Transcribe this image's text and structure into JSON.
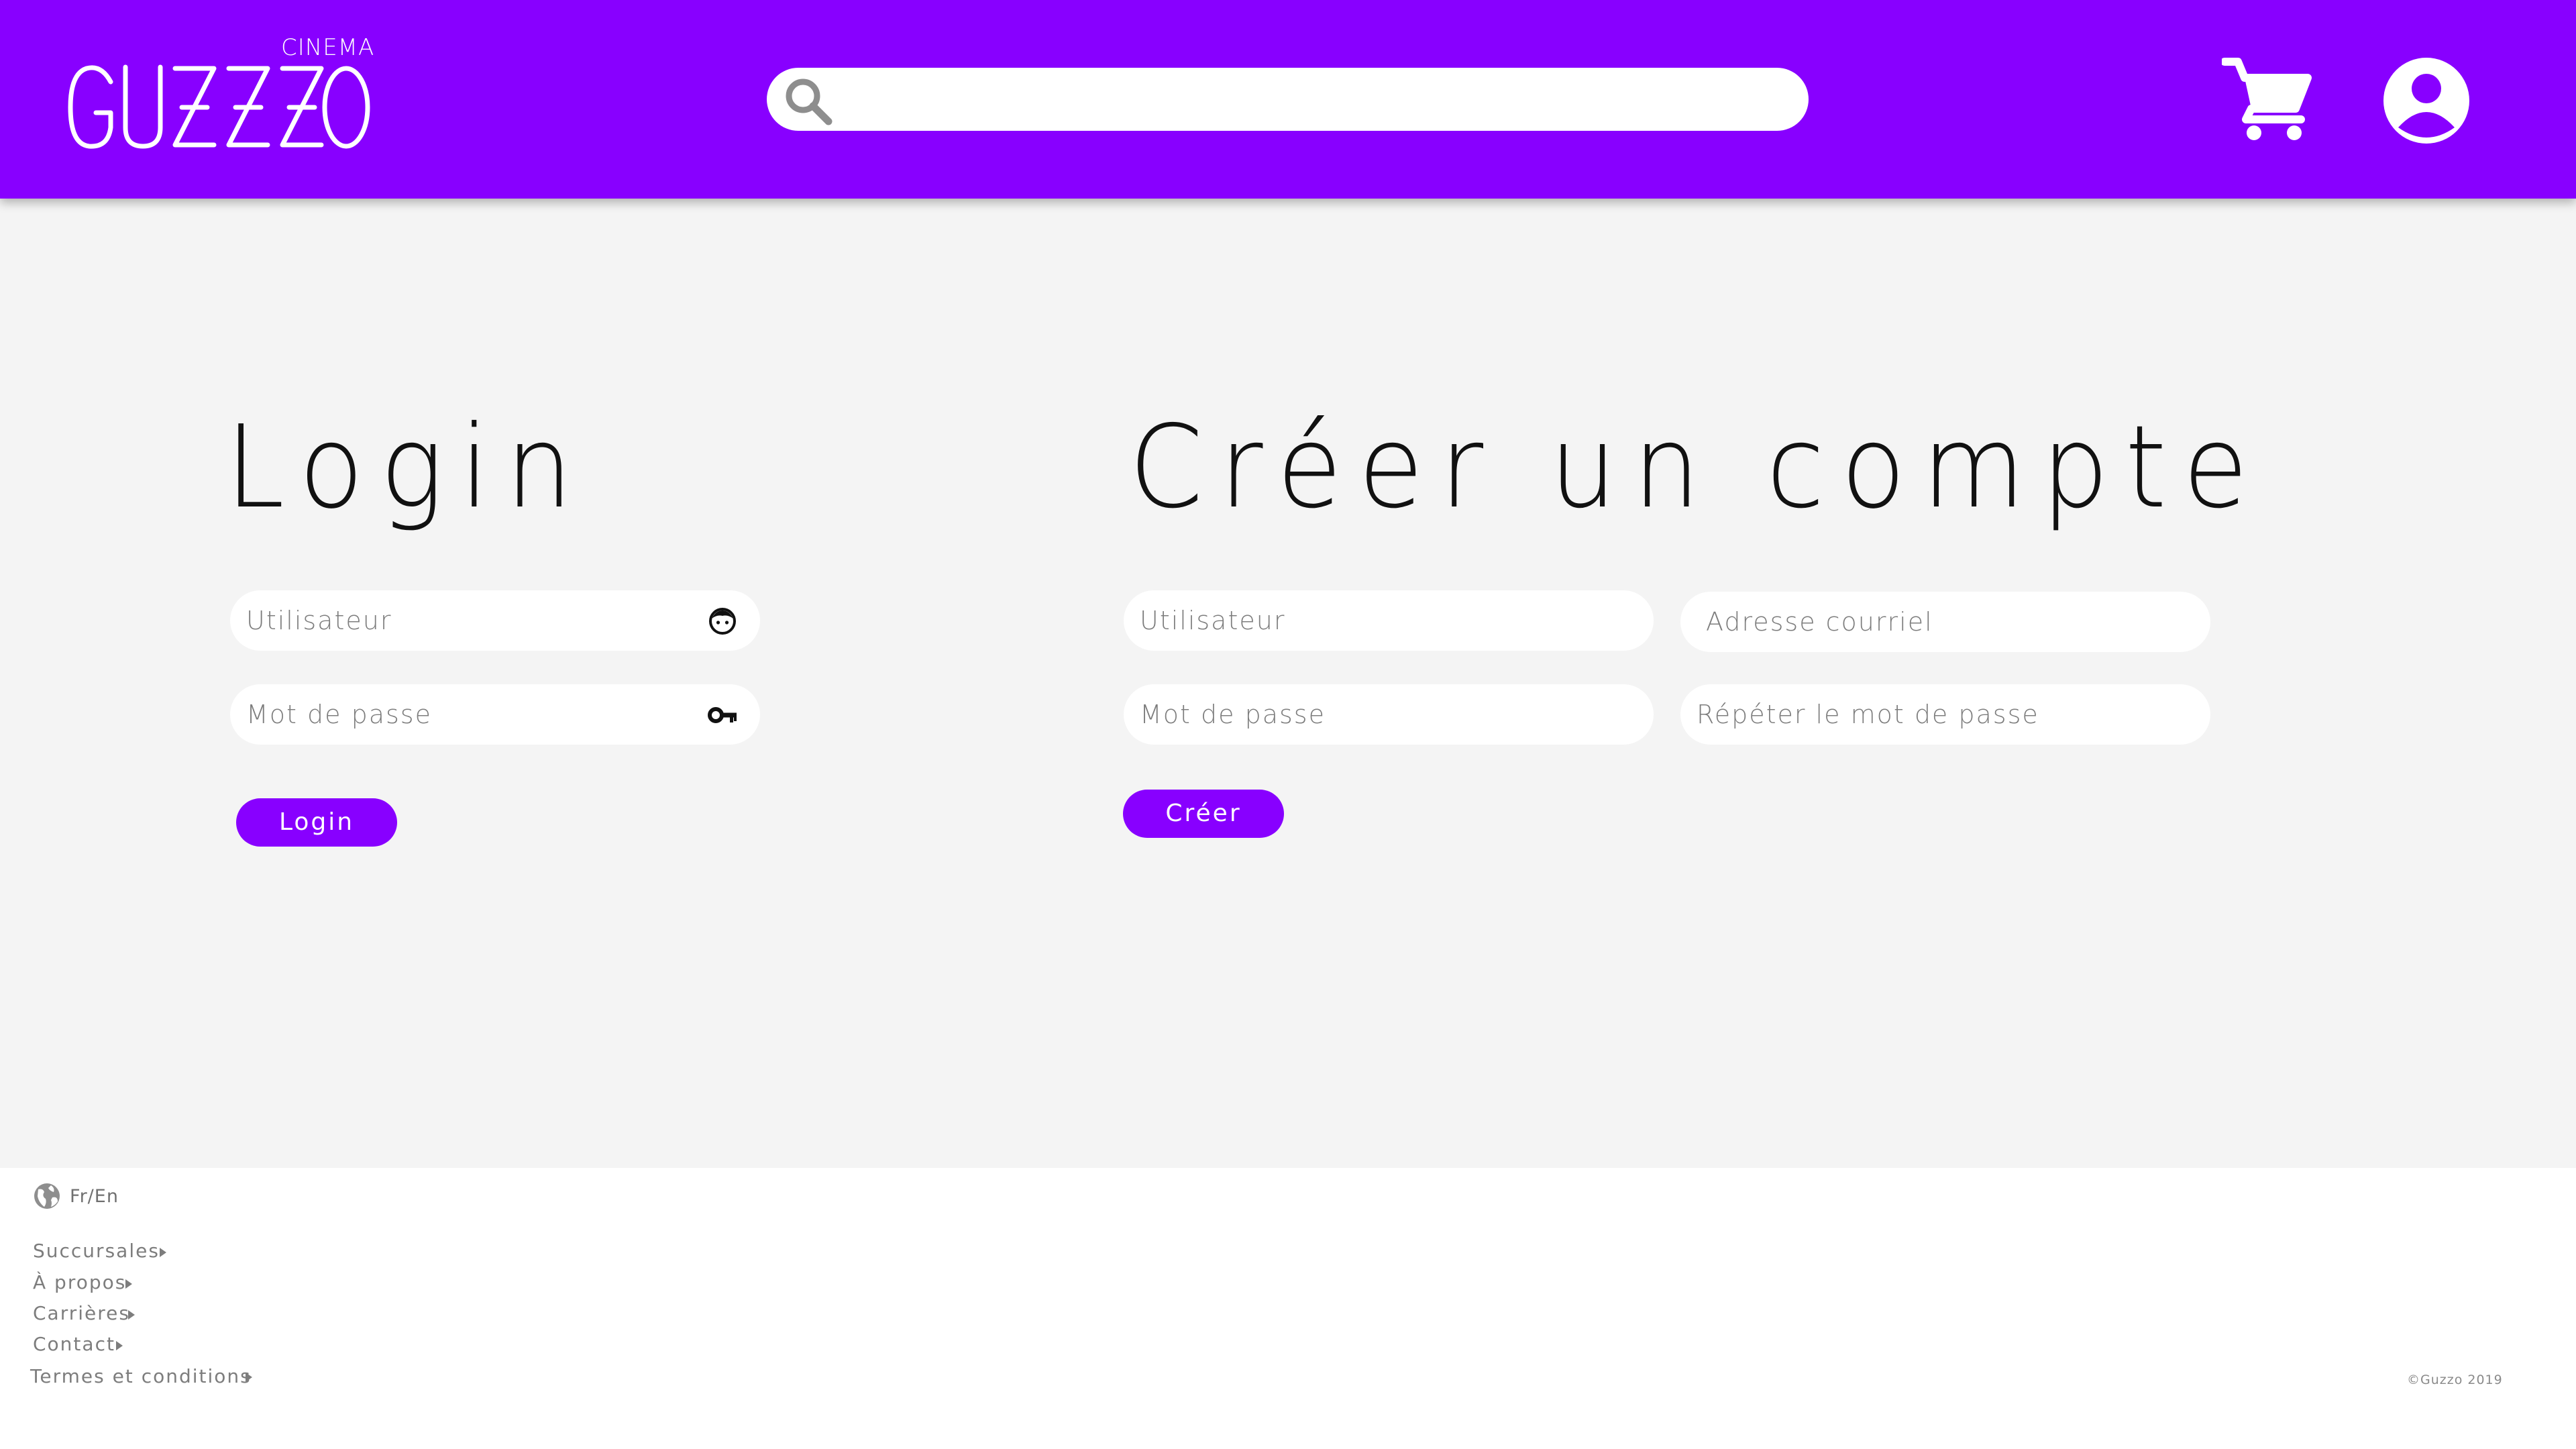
{
  "header": {
    "logo_brand": "GUZZO",
    "logo_subtitle": "CINEMA",
    "search_placeholder": "",
    "colors": {
      "primary": "#8800ff",
      "white": "#ffffff"
    },
    "icons": {
      "search": "search-icon",
      "cart": "cart-icon",
      "account": "account-icon"
    }
  },
  "login": {
    "title": "Login",
    "username_placeholder": "Utilisateur",
    "password_placeholder": "Mot de passe",
    "button_label": "Login",
    "icons": {
      "username": "face-icon",
      "password": "key-icon"
    }
  },
  "register": {
    "title": "Créer un compte",
    "username_placeholder": "Utilisateur",
    "email_placeholder": "Adresse courriel",
    "password_placeholder": "Mot de passe",
    "repeat_password_placeholder": "Répéter le mot de passe",
    "button_label": "Créer"
  },
  "footer": {
    "language_label": "Fr/En",
    "links": [
      {
        "label": "Succursales"
      },
      {
        "label": "À propos"
      },
      {
        "label": "Carrières"
      },
      {
        "label": "Contact"
      },
      {
        "label": "Termes et conditions"
      }
    ],
    "copyright": "©Guzzo 2019"
  },
  "colors": {
    "background": "#f4f4f4",
    "footer_background": "#ffffff",
    "text_dark": "#111111",
    "text_muted": "#7d7d7d"
  }
}
